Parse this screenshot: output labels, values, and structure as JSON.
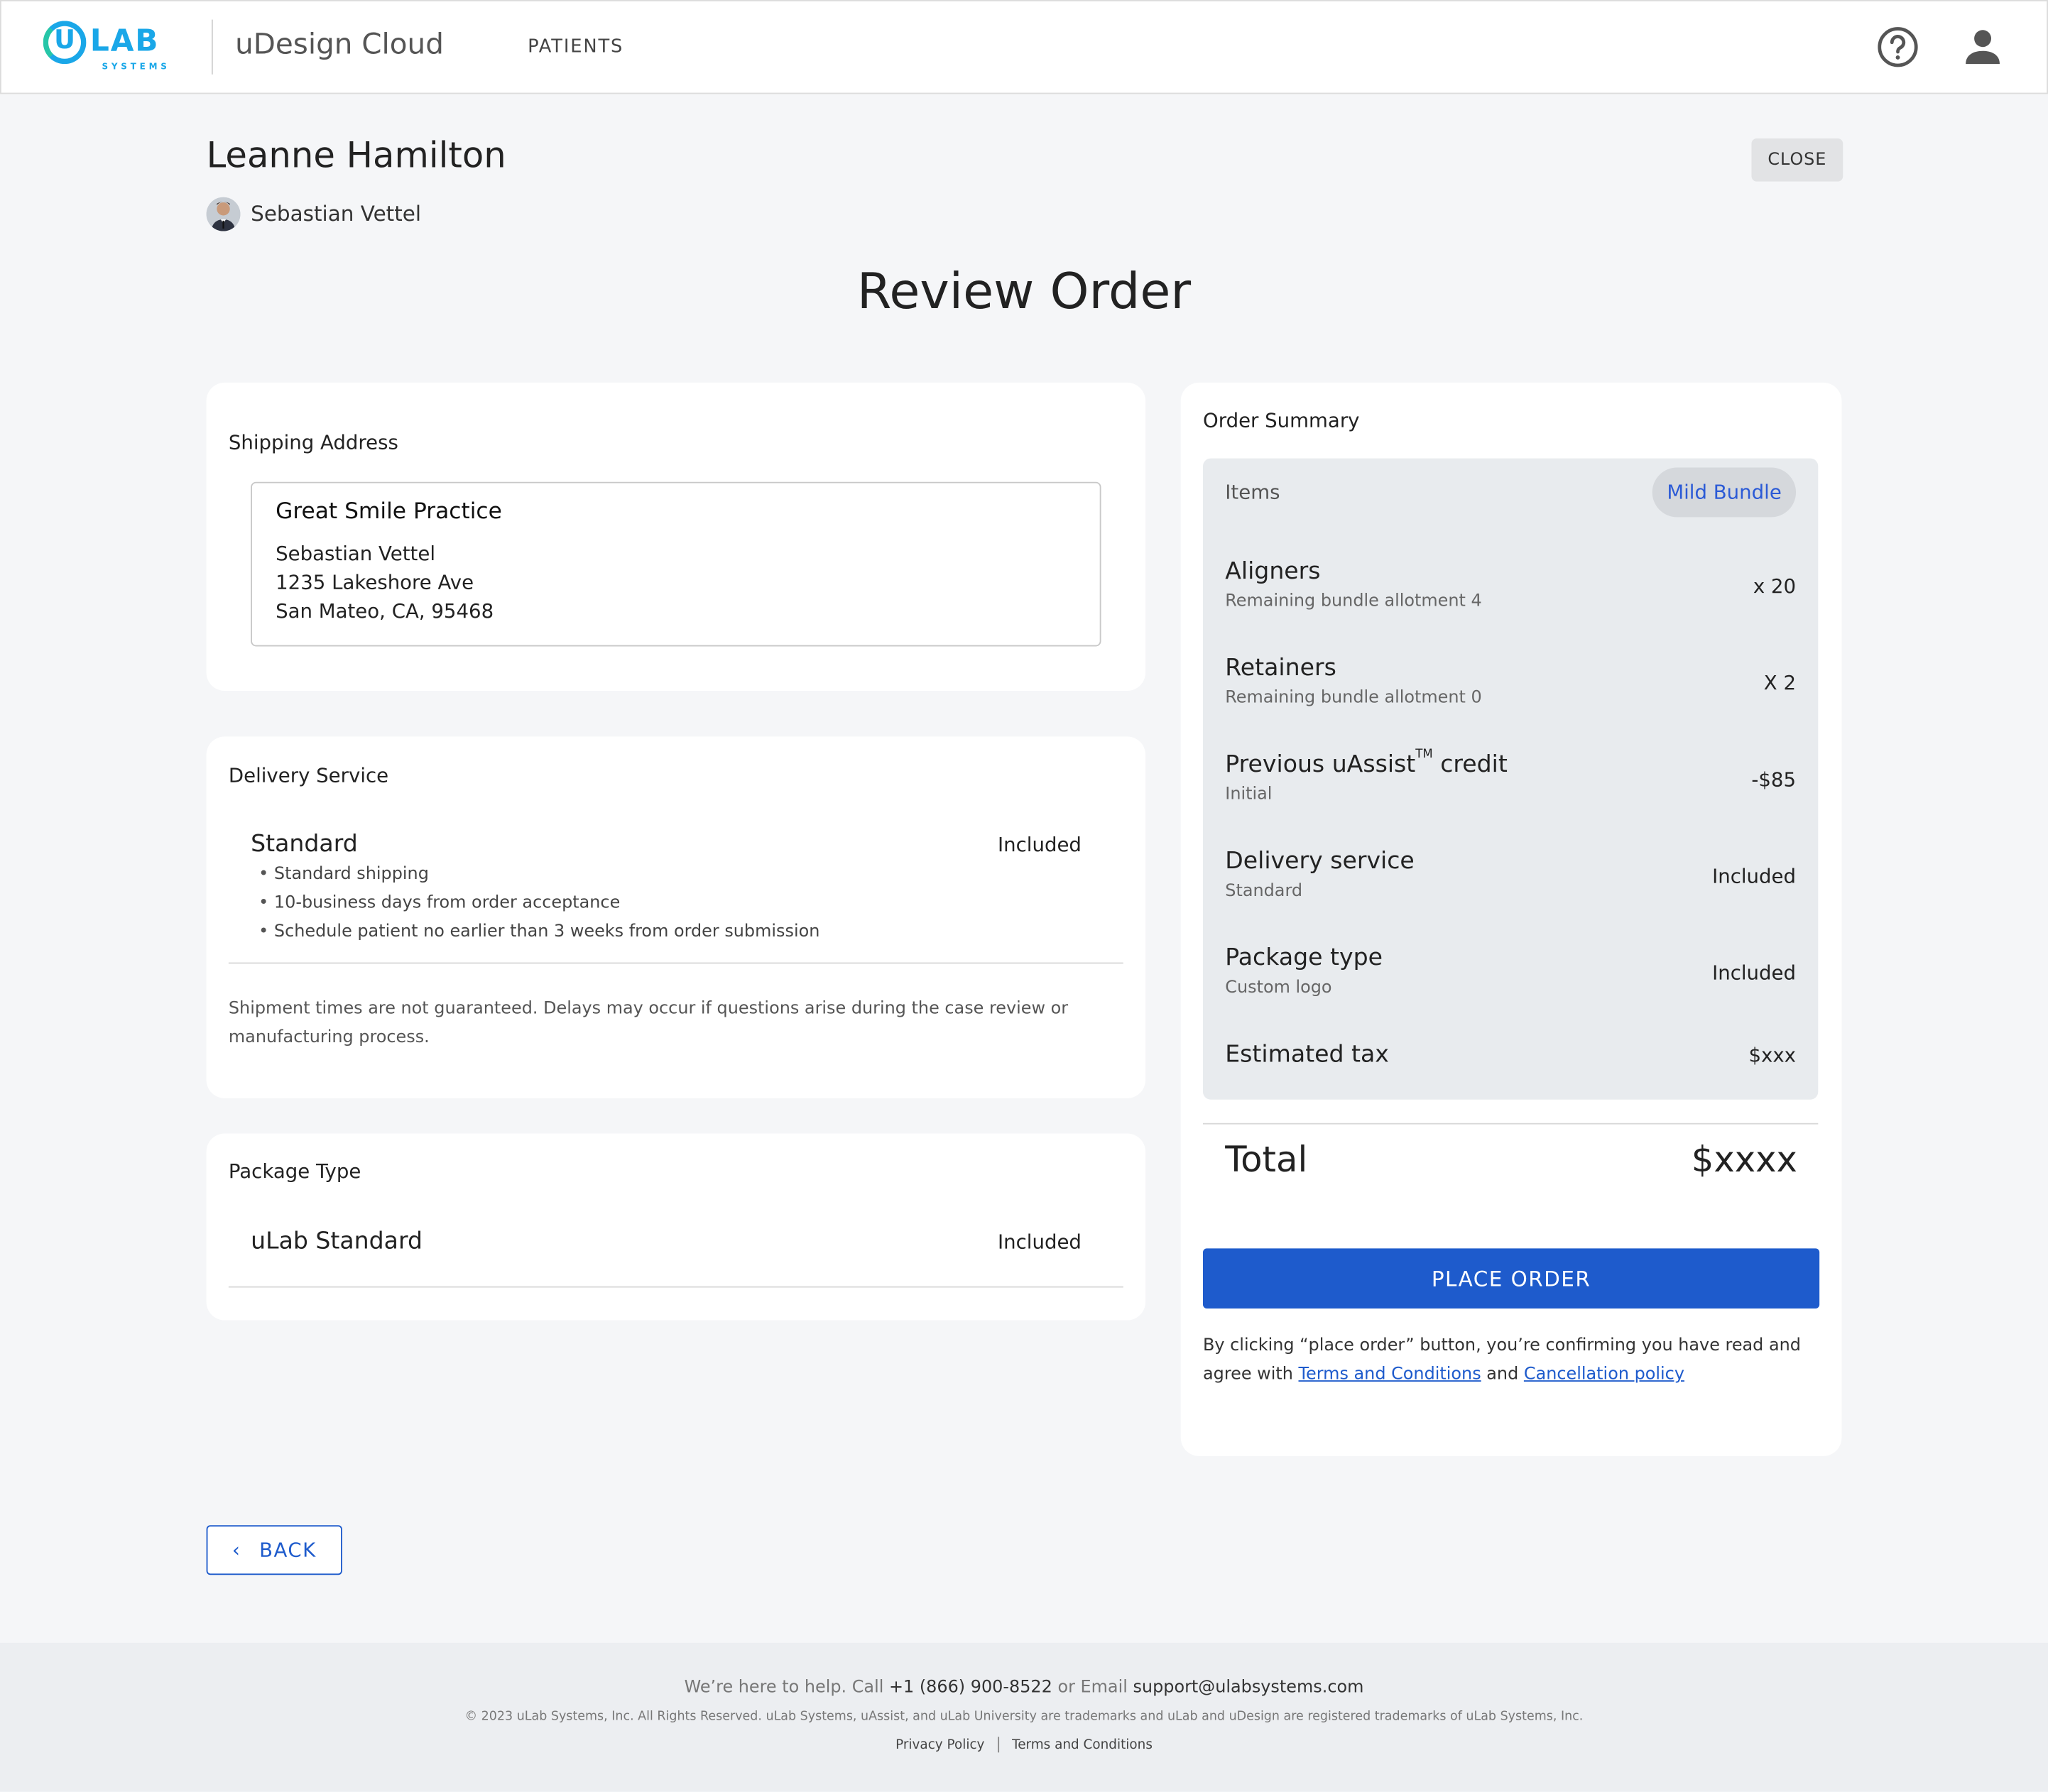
{
  "header": {
    "logo_text": "LAB",
    "logo_u": "U",
    "logo_sub": "SYSTEMS",
    "app_name": "uDesign Cloud",
    "nav": [
      "PATIENTS"
    ]
  },
  "patient": {
    "name": "Leanne Hamilton",
    "doctor": "Sebastian Vettel",
    "close_label": "CLOSE"
  },
  "page_title": "Review Order",
  "shipping": {
    "title": "Shipping Address",
    "practice": "Great Smile Practice",
    "lines": [
      "Sebastian Vettel",
      "1235 Lakeshore Ave",
      "San Mateo, CA, 95468"
    ]
  },
  "delivery": {
    "title": "Delivery Service",
    "name": "Standard",
    "price": "Included",
    "bullets": [
      "Standard shipping",
      "10-business days from order acceptance",
      "Schedule patient no earlier than 3 weeks from order submission"
    ],
    "note": "Shipment times are not guaranteed. Delays may occur if questions arise during the case review or manufacturing process."
  },
  "package": {
    "title": "Package Type",
    "name": "uLab Standard",
    "price": "Included"
  },
  "summary": {
    "title": "Order Summary",
    "items_label": "Items",
    "bundle": "Mild Bundle",
    "rows": [
      {
        "title": "Aligners",
        "sub": "Remaining bundle allotment 4",
        "value": "x 20"
      },
      {
        "title": "Retainers",
        "sub": "Remaining bundle allotment 0",
        "value": "X 2"
      },
      {
        "title": "Previous uAssist",
        "title_tm": "TM",
        "title_suffix": " credit",
        "sub": "Initial",
        "value": "-$85"
      },
      {
        "title": "Delivery service",
        "sub": "Standard",
        "value": "Included"
      },
      {
        "title": "Package type",
        "sub": "Custom logo",
        "value": "Included"
      },
      {
        "title": "Estimated tax",
        "sub": "",
        "value": "$xxx"
      }
    ],
    "total_label": "Total",
    "total_value": "$xxxx",
    "place_order": "PLACE ORDER",
    "consent_prefix": "By clicking “place order” button, you’re confirming you have read and agree with ",
    "terms_link": "Terms and Conditions",
    "consent_and": " and ",
    "cancel_link": "Cancellation policy"
  },
  "back_label": "BACK",
  "footer": {
    "help_prefix": "We’re here to help. Call ",
    "phone": "+1 (866) 900-8522",
    "email_prefix": " or Email ",
    "email": "support@ulabsystems.com",
    "copyright": "© 2023 uLab Systems, Inc. All Rights Reserved. uLab Systems, uAssist, and uLab University are trademarks and uLab and uDesign are registered trademarks of uLab Systems, Inc.",
    "privacy": "Privacy Policy",
    "terms": "Terms and Conditions"
  },
  "colors": {
    "primary": "#1e5bcc",
    "logo": "#1aa7e8",
    "background": "#f5f6f8",
    "summary_box": "#e8ebee"
  }
}
